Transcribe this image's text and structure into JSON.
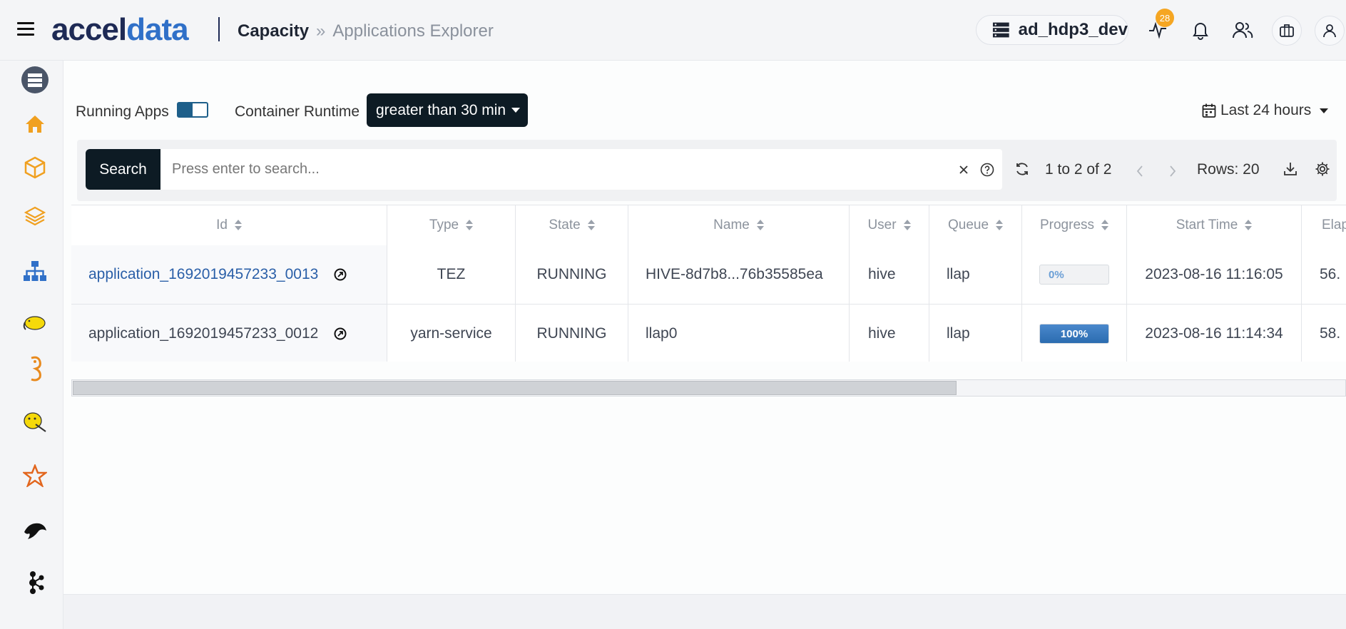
{
  "header": {
    "logo_prefix": "accel",
    "logo_suffix": "data",
    "breadcrumb_current": "Capacity",
    "breadcrumb_separator": "»",
    "breadcrumb_page": "Applications Explorer",
    "cluster_name": "ad_hdp3_dev",
    "notification_count": "28",
    "colors": {
      "accent": "#3070c8",
      "brand": "#1e2a55",
      "badge": "#f5a623"
    }
  },
  "sidebar": {
    "items": [
      {
        "icon": "cluster-icon"
      },
      {
        "icon": "home-icon"
      },
      {
        "icon": "box-icon"
      },
      {
        "icon": "layers-icon"
      },
      {
        "icon": "hierarchy-icon"
      },
      {
        "icon": "hadoop-elephant-icon"
      },
      {
        "icon": "zookeeper-icon"
      },
      {
        "icon": "hive-icon"
      },
      {
        "icon": "spark-star-icon"
      },
      {
        "icon": "mysql-dolphin-icon"
      },
      {
        "icon": "kafka-icon"
      }
    ]
  },
  "filters": {
    "running_apps_label": "Running Apps",
    "running_apps_on": true,
    "container_runtime_label": "Container Runtime",
    "container_runtime_value": "greater than 30 min",
    "date_range": "Last 24 hours"
  },
  "toolbar": {
    "search_label": "Search",
    "search_placeholder": "Press enter to search...",
    "pagination": "1 to 2 of 2",
    "rows": "Rows: 20"
  },
  "table": {
    "columns": [
      "Id",
      "Type",
      "State",
      "Name",
      "User",
      "Queue",
      "Progress",
      "Start Time",
      "Elap"
    ],
    "rows": [
      {
        "id": "application_1692019457233_0013",
        "type": "TEZ",
        "state": "RUNNING",
        "name": "HIVE-8d7b8...76b35585ea",
        "user": "hive",
        "queue": "llap",
        "progress": 0,
        "progress_label": "0%",
        "start_time": "2023-08-16 11:16:05",
        "elapsed": "56."
      },
      {
        "id": "application_1692019457233_0012",
        "type": "yarn-service",
        "state": "RUNNING",
        "name": "llap0",
        "user": "hive",
        "queue": "llap",
        "progress": 100,
        "progress_label": "100%",
        "start_time": "2023-08-16 11:14:34",
        "elapsed": "58."
      }
    ]
  }
}
